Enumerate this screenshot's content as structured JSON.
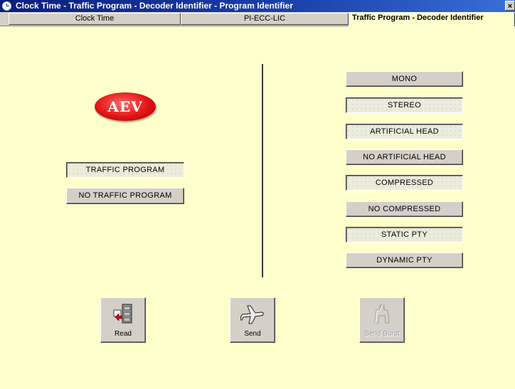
{
  "window": {
    "title": "Clock Time - Traffic Program - Decoder Identifier - Program Identifier",
    "close_label": "×"
  },
  "tabs": [
    {
      "label": "Clock Time",
      "active": false
    },
    {
      "label": "PI-ECC-LIC",
      "active": false
    },
    {
      "label": "Traffic Program - Decoder Identifier",
      "active": true
    }
  ],
  "logo": {
    "text": "AEV",
    "color": "#e01414"
  },
  "traffic": {
    "traffic_program": "TRAFFIC PROGRAM",
    "no_traffic_program": "NO TRAFFIC PROGRAM"
  },
  "decoder": {
    "mono": "MONO",
    "stereo": "STEREO",
    "artificial_head": "ARTIFICIAL HEAD",
    "no_artificial_head": "NO ARTIFICIAL HEAD",
    "compressed": "COMPRESSED",
    "no_compressed": "NO COMPRESSED",
    "static_pty": "STATIC PTY",
    "dynamic_pty": "DYNAMIC PTY"
  },
  "actions": {
    "read": {
      "label": "Read",
      "icon": "read-icon"
    },
    "send": {
      "label": "Send",
      "icon": "airplane-icon"
    },
    "send_burst": {
      "label": "Send Burst",
      "icon": "send-burst-icon",
      "disabled": true
    }
  },
  "colors": {
    "background": "#ffffcc",
    "titlebar": "#0a1f7a",
    "button_face": "#d4d0c8"
  }
}
